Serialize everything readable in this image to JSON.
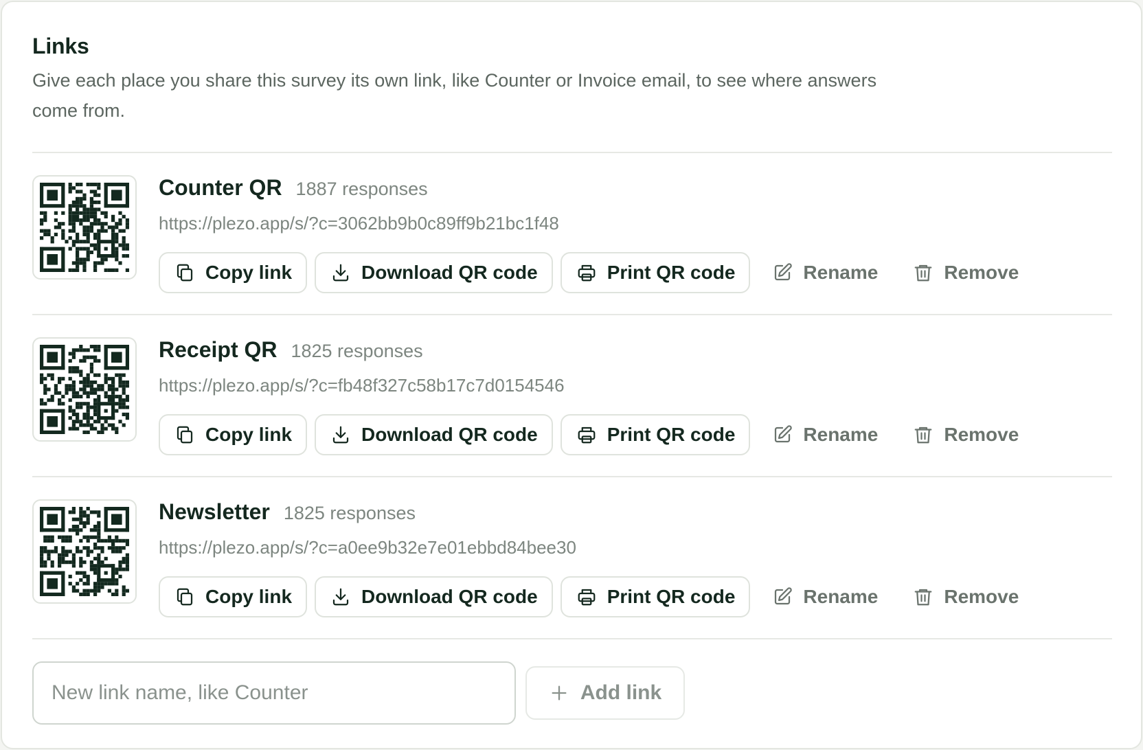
{
  "section": {
    "title": "Links",
    "description": "Give each place you share this survey its own link, like Counter or Invoice email, to see where answers come from."
  },
  "links": [
    {
      "name": "Counter QR",
      "responses": "1887 responses",
      "url": "https://plezo.app/s/?c=3062bb9b0c89ff9b21bc1f48"
    },
    {
      "name": "Receipt QR",
      "responses": "1825 responses",
      "url": "https://plezo.app/s/?c=fb48f327c58b17c7d0154546"
    },
    {
      "name": "Newsletter",
      "responses": "1825 responses",
      "url": "https://plezo.app/s/?c=a0ee9b32e7e01ebbd84bee30"
    }
  ],
  "actions": {
    "copy": "Copy link",
    "download": "Download QR code",
    "print": "Print QR code",
    "rename": "Rename",
    "remove": "Remove"
  },
  "new_link": {
    "placeholder": "New link name, like Counter",
    "add_label": "Add link"
  },
  "icons": {
    "copy": "copy-icon",
    "download": "download-icon",
    "print": "printer-icon",
    "rename": "pencil-icon",
    "remove": "trash-icon",
    "add": "plus-icon",
    "qr": "qr-code-icon"
  },
  "colors": {
    "text": "#14281f",
    "muted": "#7d8680",
    "border": "#dfe3dd",
    "qr": "#13291f"
  }
}
